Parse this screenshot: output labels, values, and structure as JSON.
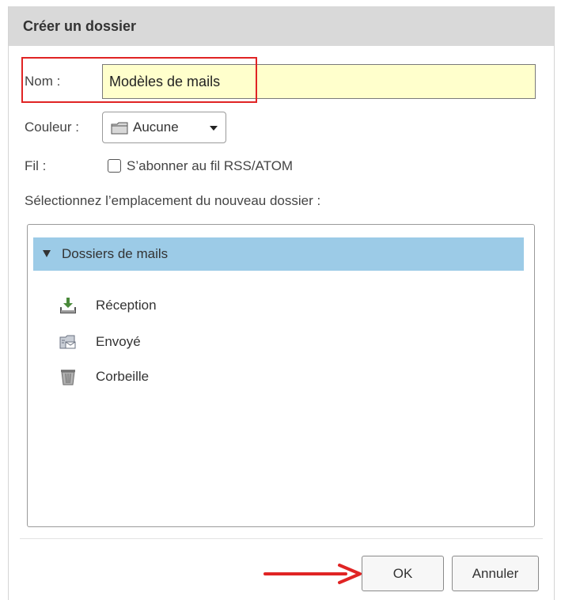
{
  "dialog": {
    "title": "Créer un dossier"
  },
  "form": {
    "name_label": "Nom :",
    "name_value": "Modèles de mails",
    "color_label": "Couleur :",
    "color_value": "Aucune",
    "feed_label": "Fil :",
    "feed_checkbox_label": "S’abonner au fil RSS/ATOM",
    "feed_checked": false,
    "location_prompt": "Sélectionnez l’emplacement du nouveau dossier :"
  },
  "tree": {
    "root": {
      "label": "Dossiers de mails",
      "expanded": true
    },
    "items": [
      {
        "label": "Réception",
        "icon": "inbox-download-icon"
      },
      {
        "label": "Envoyé",
        "icon": "sent-folder-icon"
      },
      {
        "label": "Corbeille",
        "icon": "trash-icon"
      }
    ]
  },
  "buttons": {
    "ok_label": "OK",
    "cancel_label": "Annuler"
  },
  "colors": {
    "titlebar_bg": "#d9d9d9",
    "name_field_bg": "#ffffcc",
    "tree_selection_bg": "#9ccbe7",
    "annotation_red": "#e02424"
  }
}
